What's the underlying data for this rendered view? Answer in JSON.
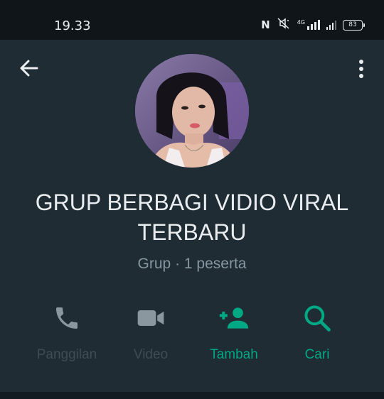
{
  "status_bar": {
    "time": "19.33",
    "network_label": "4G",
    "battery": "83",
    "icons": [
      "nfc-icon",
      "mute-icon",
      "signal-icon",
      "battery-icon"
    ]
  },
  "toolbar": {
    "back_icon": "arrow-left-icon",
    "menu_icon": "more-vertical-icon"
  },
  "profile": {
    "group_name": "GRUP BERBAGI VIDIO VIRAL TERBARU",
    "subtitle": "Grup · 1 peserta"
  },
  "actions": [
    {
      "label": "Panggilan",
      "icon": "phone-icon",
      "state": "disabled"
    },
    {
      "label": "Video",
      "icon": "video-camera-icon",
      "state": "disabled"
    },
    {
      "label": "Tambah",
      "icon": "add-person-icon",
      "state": "active"
    },
    {
      "label": "Cari",
      "icon": "search-icon",
      "state": "active"
    }
  ],
  "colors": {
    "background": "#121b22",
    "panel": "#1f2c34",
    "primary_text": "#e9edef",
    "secondary_text": "#8696a0",
    "accent_green": "#00a884",
    "disabled_text": "#3f4c55"
  }
}
